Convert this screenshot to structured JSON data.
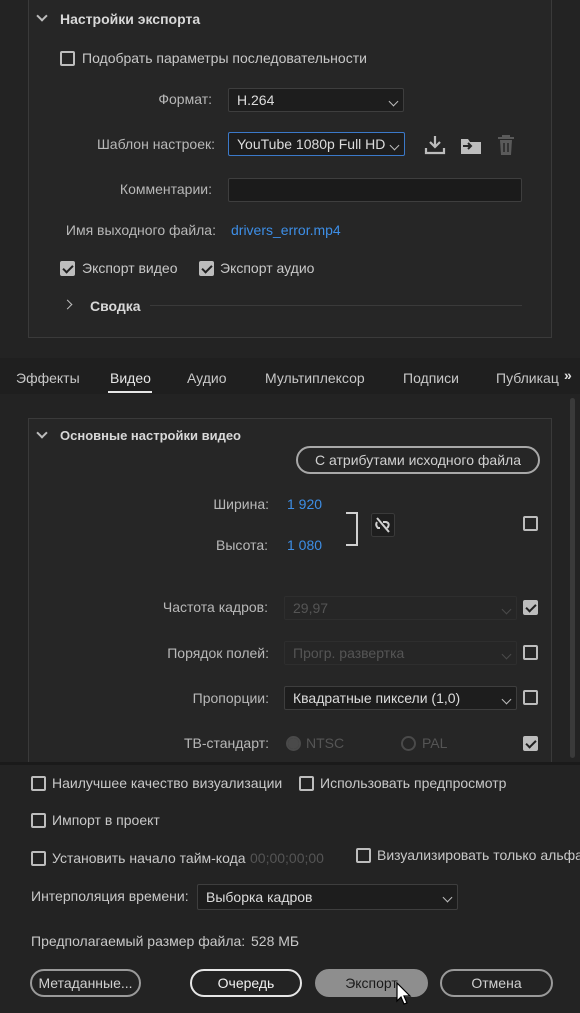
{
  "export_settings": {
    "title": "Настройки экспорта",
    "match_sequence_label": "Подобрать параметры последовательности",
    "format_label": "Формат:",
    "format_value": "H.264",
    "preset_label": "Шаблон настроек:",
    "preset_value": "YouTube 1080p Full HD",
    "comments_label": "Комментарии:",
    "comments_value": "",
    "output_name_label": "Имя выходного файла:",
    "output_name_value": "drivers_error.mp4",
    "export_video_label": "Экспорт видео",
    "export_audio_label": "Экспорт аудио",
    "summary_label": "Сводка"
  },
  "tabs": [
    "Эффекты",
    "Видео",
    "Аудио",
    "Мультиплексор",
    "Подписи",
    "Публикац"
  ],
  "video": {
    "title": "Основные настройки видео",
    "match_source_button": "С атрибутами исходного файла",
    "width_label": "Ширина:",
    "width_value": "1 920",
    "height_label": "Высота:",
    "height_value": "1 080",
    "framerate_label": "Частота кадров:",
    "framerate_value": "29,97",
    "field_order_label": "Порядок полей:",
    "field_order_value": "Прогр. развертка",
    "aspect_label": "Пропорции:",
    "aspect_value": "Квадратные пиксели (1,0)",
    "tv_standard_label": "ТВ-стандарт:",
    "ntsc_label": "NTSC",
    "pal_label": "PAL"
  },
  "bottom": {
    "max_render_label": "Наилучшее качество визуализации",
    "use_previews_label": "Использовать предпросмотр",
    "import_label": "Импорт в проект",
    "set_timecode_label": "Установить начало тайм-кода",
    "timecode_value": "00;00;00;00",
    "alpha_only_label": "Визуализировать только альфа-",
    "interp_label": "Интерполяция времени:",
    "interp_value": "Выборка кадров",
    "filesize_label": "Предполагаемый размер файла:",
    "filesize_value": "528 МБ",
    "metadata_button": "Метаданные...",
    "queue_button": "Очередь",
    "export_button": "Экспорт",
    "cancel_button": "Отмена"
  }
}
